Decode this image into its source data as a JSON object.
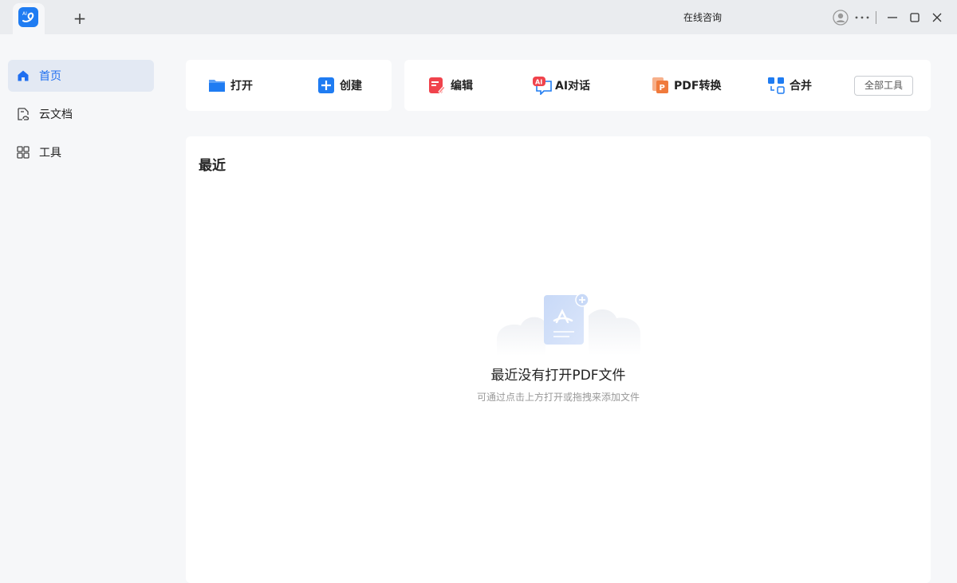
{
  "titlebar": {
    "new_tab_label": "+",
    "consult_label": "在线咨询"
  },
  "sidebar": {
    "items": [
      {
        "label": "首页",
        "icon": "home-icon",
        "active": true
      },
      {
        "label": "云文档",
        "icon": "cloud-doc-icon",
        "active": false
      },
      {
        "label": "工具",
        "icon": "grid-icon",
        "active": false
      }
    ]
  },
  "quick_actions": {
    "open_label": "打开",
    "create_label": "创建"
  },
  "tools": {
    "edit_label": "编辑",
    "ai_label": "AI对话",
    "convert_label": "PDF转换",
    "merge_label": "合并",
    "all_tools_label": "全部工具"
  },
  "recent": {
    "title": "最近",
    "empty_title": "最近没有打开PDF文件",
    "empty_hint": "可通过点击上方打开或拖拽来添加文件"
  },
  "colors": {
    "accent": "#1f6ff0",
    "edit_red": "#f0434c",
    "convert_orange": "#f07a3c"
  }
}
